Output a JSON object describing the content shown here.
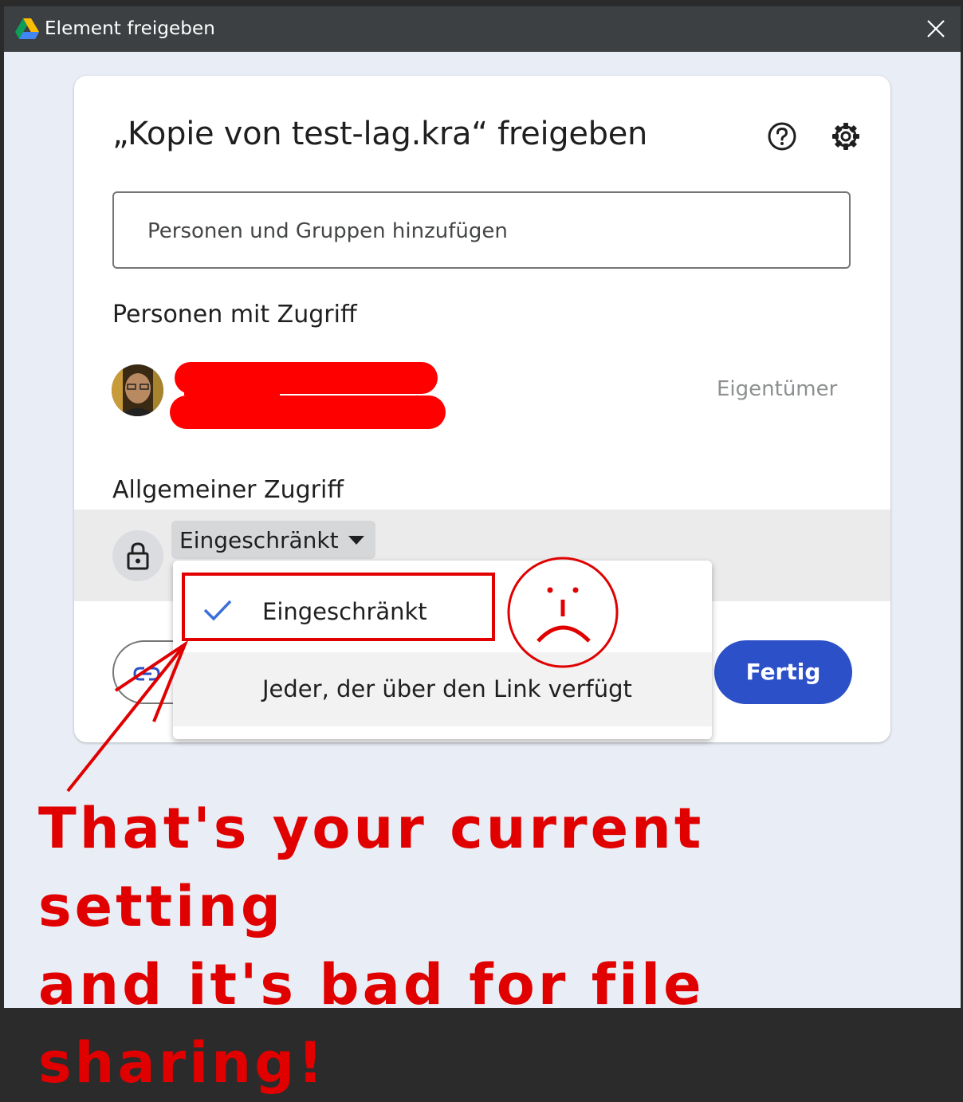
{
  "window": {
    "title": "Element freigeben",
    "close_icon": "close-icon",
    "app_icon": "google-drive-logo"
  },
  "dialog": {
    "heading": "„Kopie von test-lag.kra“ freigeben",
    "help_icon": "help-circle-icon",
    "settings_icon": "gear-icon",
    "people_input": {
      "placeholder": "Personen und Gruppen hinzufügen",
      "value": ""
    },
    "people_with_access": {
      "label": "Personen mit Zugriff",
      "people": [
        {
          "name_redacted": true,
          "role": "Eigentümer"
        }
      ]
    },
    "general_access": {
      "label": "Allgemeiner Zugriff",
      "icon": "lock-icon",
      "selected": "Eingeschränkt",
      "options": [
        {
          "label": "Eingeschränkt",
          "checked": true
        },
        {
          "label": "Jeder, der über den Link verfügt",
          "checked": false
        }
      ]
    },
    "copy_link_icon": "link-icon",
    "done_label": "Fertig"
  },
  "annotation": {
    "caption_line1": "That's your current setting",
    "caption_line2": "and it's bad for file sharing!",
    "color": "#e00000",
    "emoji": "sad-face"
  },
  "colors": {
    "titlebar": "#3c4043",
    "background": "#e9edf5",
    "primary_button": "#2c50c7",
    "check": "#3b6fd6",
    "annotation_red": "#e00000"
  }
}
